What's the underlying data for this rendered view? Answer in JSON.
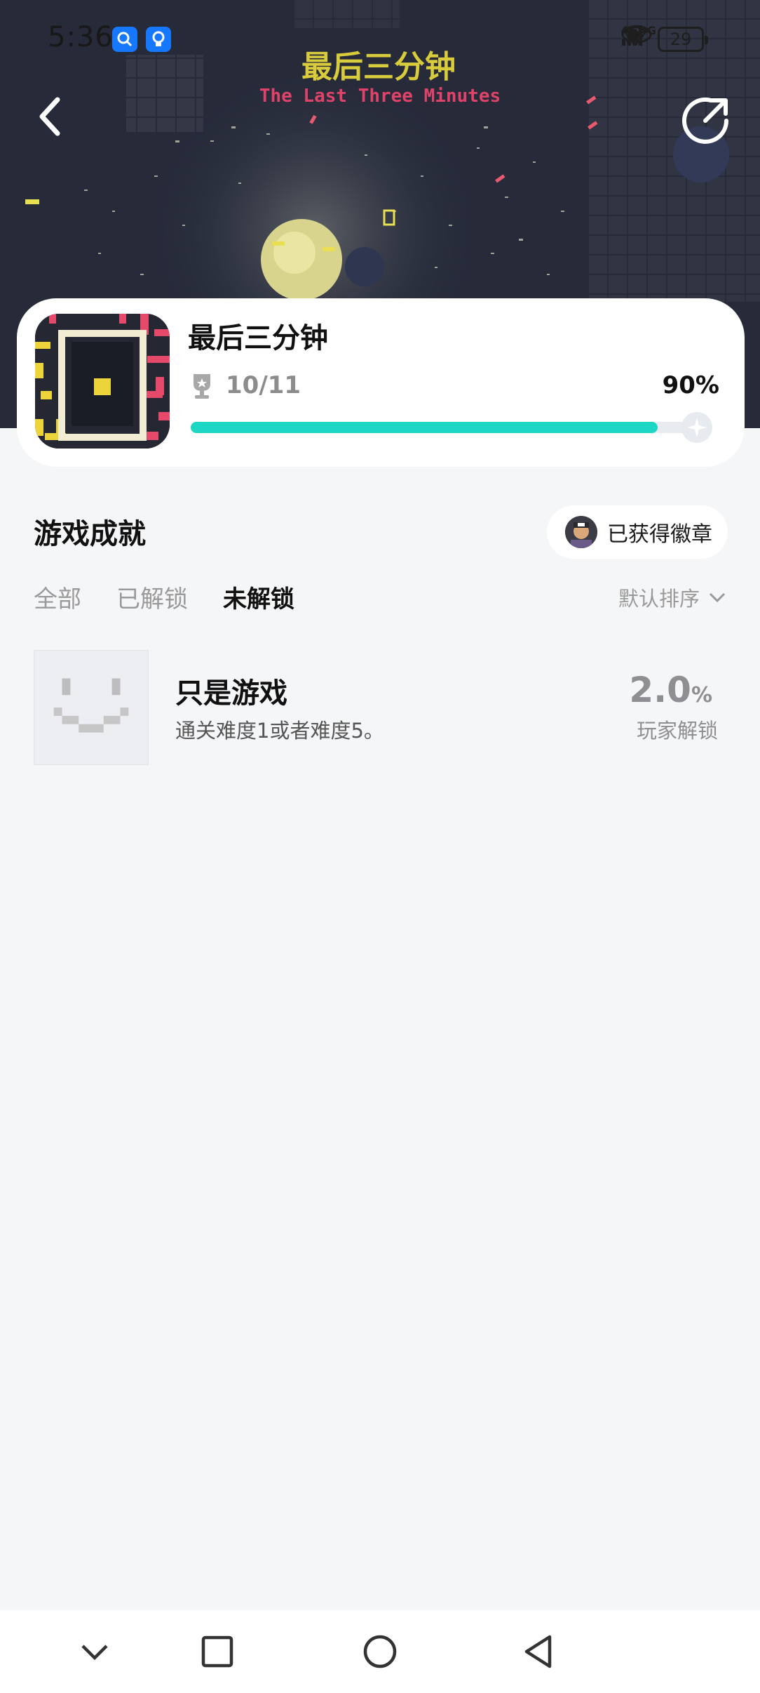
{
  "status_bar": {
    "time": "5:36",
    "battery": "29",
    "network_1": "4G",
    "network_2": "4G"
  },
  "header": {
    "banner_title": "最后三分钟",
    "banner_subtitle": "The Last Three Minutes"
  },
  "game": {
    "title": "最后三分钟",
    "trophy_count": "10/11",
    "progress_percent": "90%",
    "progress_value": 0.9,
    "accent_color": "#1dd6c4"
  },
  "achievements_section": {
    "title": "游戏成就",
    "badge_button_label": "已获得徽章",
    "tabs": [
      {
        "label": "全部",
        "active": false
      },
      {
        "label": "已解锁",
        "active": false
      },
      {
        "label": "未解锁",
        "active": true
      }
    ],
    "sort_label": "默认排序"
  },
  "achievements": [
    {
      "title": "只是游戏",
      "description": "通关难度1或者难度5。",
      "rate": "2.0",
      "rate_unit": "%",
      "rate_label": "玩家解锁",
      "icon": "pixel-smile-icon"
    }
  ],
  "navbar": {
    "icons": [
      "chevron-down-icon",
      "square-icon",
      "circle-icon",
      "triangle-back-icon"
    ]
  }
}
